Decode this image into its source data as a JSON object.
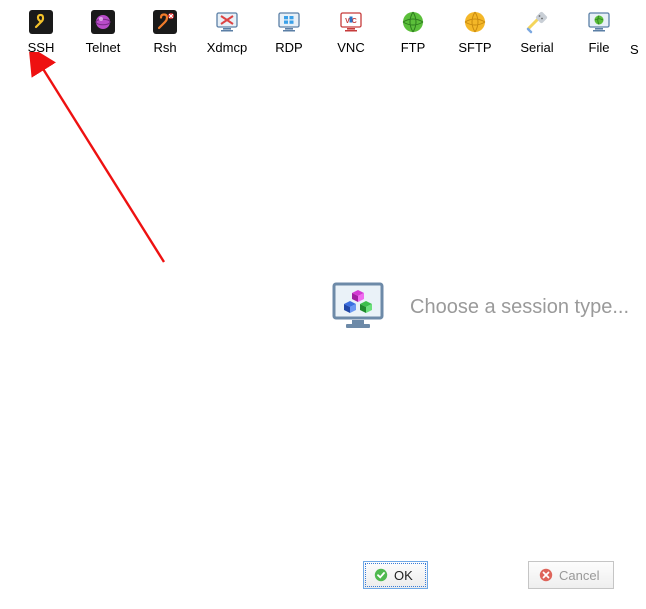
{
  "toolbar": {
    "items": [
      {
        "label": "SSH",
        "icon": "ssh-icon"
      },
      {
        "label": "Telnet",
        "icon": "telnet-icon"
      },
      {
        "label": "Rsh",
        "icon": "rsh-icon"
      },
      {
        "label": "Xdmcp",
        "icon": "xdmcp-icon"
      },
      {
        "label": "RDP",
        "icon": "rdp-icon"
      },
      {
        "label": "VNC",
        "icon": "vnc-icon"
      },
      {
        "label": "FTP",
        "icon": "ftp-icon"
      },
      {
        "label": "SFTP",
        "icon": "sftp-icon"
      },
      {
        "label": "Serial",
        "icon": "serial-icon"
      },
      {
        "label": "File",
        "icon": "file-icon"
      }
    ],
    "overflow_char": "S"
  },
  "center": {
    "prompt": "Choose a session type..."
  },
  "buttons": {
    "ok_label": "OK",
    "cancel_label": "Cancel"
  }
}
